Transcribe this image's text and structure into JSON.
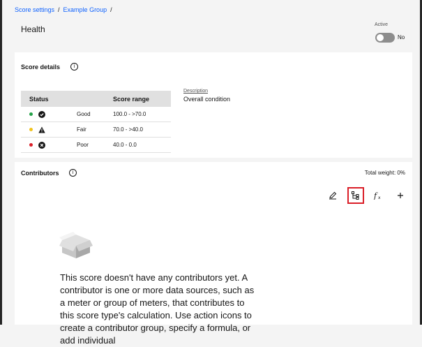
{
  "breadcrumb": {
    "items": [
      "Score settings",
      "Example Group"
    ],
    "separator": "/"
  },
  "header": {
    "title": "Health",
    "active_label": "Active",
    "toggle_value": "No"
  },
  "score_details": {
    "title": "Score details",
    "info_icon": "info-icon",
    "columns": [
      "Status",
      "Score range"
    ],
    "rows": [
      {
        "dot_color": "#24a148",
        "icon": "check-circle-icon",
        "label": "Good",
        "range": "100.0 - >70.0"
      },
      {
        "dot_color": "#f1c21b",
        "icon": "warning-triangle-icon",
        "label": "Fair",
        "range": "70.0 - >40.0"
      },
      {
        "dot_color": "#da1e28",
        "icon": "error-circle-icon",
        "label": "Poor",
        "range": "40.0 - 0.0"
      }
    ],
    "description_label": "Description",
    "description_value": "Overall condition"
  },
  "contributors": {
    "title": "Contributors",
    "total_weight": "Total weight: 0%",
    "actions": [
      {
        "icon": "edit-icon"
      },
      {
        "icon": "hierarchy-icon",
        "highlighted": true
      },
      {
        "icon": "function-icon"
      },
      {
        "icon": "add-icon"
      }
    ],
    "empty_icon": "empty-box-icon",
    "empty_text": "This score doesn't have any contributors yet. A contributor is one or more data sources, such as a meter or group of meters, that contributes to this score type's calculation. Use action icons to create a contributor group, specify a formula, or add individual"
  }
}
